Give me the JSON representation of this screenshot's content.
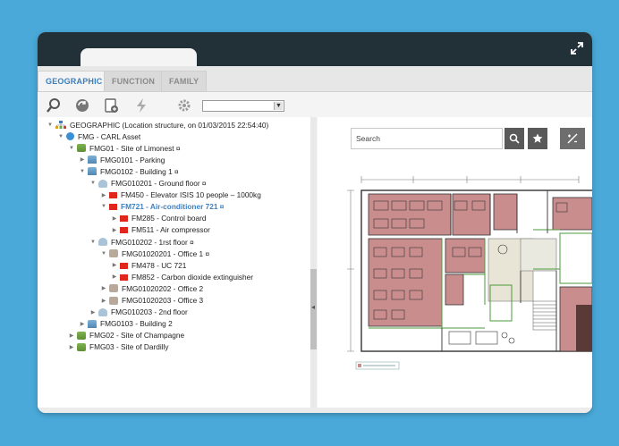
{
  "tabs": [
    {
      "label": "GEOGRAPHIC",
      "active": true
    },
    {
      "label": "FUNCTION",
      "active": false
    },
    {
      "label": "FAMILY",
      "active": false
    }
  ],
  "toolbar": {
    "icons": [
      "search-icon",
      "refresh-icon",
      "new-document-icon",
      "lightning-icon",
      "gear-icon"
    ],
    "select_value": ""
  },
  "tree": [
    {
      "label": "GEOGRAPHIC (Location structure, on 01/03/2015 22:54:40)",
      "icon": "org",
      "toggle": "▼"
    },
    {
      "label": "FMG - CARL Asset",
      "icon": "globe",
      "toggle": "▼"
    },
    {
      "label": "FMG01 - Site of Limonest ¤",
      "icon": "site",
      "toggle": "▼"
    },
    {
      "label": "FMG0101 - Parking",
      "icon": "bldg",
      "toggle": "▶"
    },
    {
      "label": "FMG0102 - Building 1 ¤",
      "icon": "bldg",
      "toggle": "▼"
    },
    {
      "label": "FMG010201 - Ground floor ¤",
      "icon": "floor",
      "toggle": "▼"
    },
    {
      "label": "FM450 - Elevator ISIS 10 people – 1000kg",
      "icon": "eq",
      "toggle": "▶"
    },
    {
      "label": "FM721 - Air-conditioner 721 ¤",
      "icon": "eq",
      "toggle": "▼",
      "selected": true
    },
    {
      "label": "FM285 - Control board",
      "icon": "eq",
      "toggle": "▶"
    },
    {
      "label": "FM511 - Air compressor",
      "icon": "eq",
      "toggle": "▶"
    },
    {
      "label": "FMG010202 - 1rst floor ¤",
      "icon": "floor",
      "toggle": "▼"
    },
    {
      "label": "FMG01020201 - Office 1 ¤",
      "icon": "office",
      "toggle": "▼"
    },
    {
      "label": "FM478 - UC 721",
      "icon": "eq",
      "toggle": "▶"
    },
    {
      "label": "FM852 - Carbon dioxide extinguisher",
      "icon": "eq",
      "toggle": "▶"
    },
    {
      "label": "FMG01020202 - Office 2",
      "icon": "office",
      "toggle": "▶"
    },
    {
      "label": "FMG01020203 - Office 3",
      "icon": "office",
      "toggle": "▶"
    },
    {
      "label": "FMG010203 - 2nd floor",
      "icon": "floor",
      "toggle": "▶"
    },
    {
      "label": "FMG0103 - Building 2",
      "icon": "bldg",
      "toggle": "▶"
    },
    {
      "label": "FMG02 - Site of Champagne",
      "icon": "site",
      "toggle": "▶"
    },
    {
      "label": "FMG03 - Site of Dardilly",
      "icon": "site",
      "toggle": "▶"
    }
  ],
  "search": {
    "placeholder": "Search"
  },
  "plan_buttons": [
    "search-icon",
    "star-icon",
    "fit-plan-icon"
  ],
  "colors": {
    "background": "#4aa9d9",
    "titlebar": "#223038",
    "tab_active": "#3a7fc0",
    "selected_item": "#3b82c4",
    "equipment_red": "#e0251b",
    "room_highlight": "#c98d8d"
  }
}
